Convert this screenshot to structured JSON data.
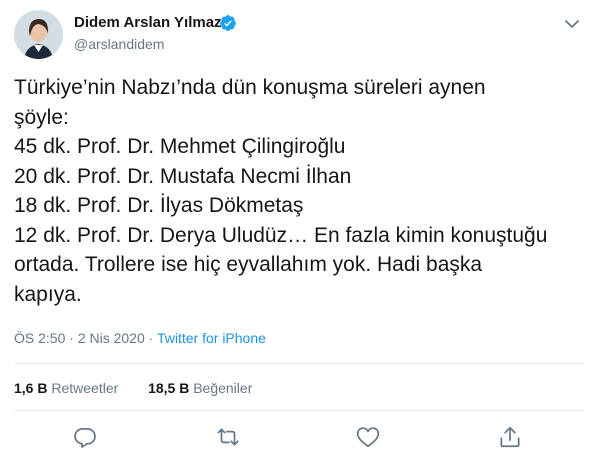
{
  "author": {
    "name": "Didem Arslan Yılmaz",
    "handle": "@arslandidem"
  },
  "tweet": {
    "lines": [
      "Türkiye’nin Nabzı’nda dün konuşma süreleri aynen",
      "şöyle:",
      "45 dk. Prof. Dr. Mehmet Çilingiroğlu",
      "20 dk. Prof. Dr. Mustafa Necmi İlhan",
      "18 dk. Prof. Dr. İlyas Dökmetaş",
      "12 dk. Prof. Dr. Derya Uludüz… En fazla kimin konuştuğu",
      "ortada. Trollere ise hiç eyvallahım yok. Hadi başka",
      "kapıya."
    ]
  },
  "meta": {
    "time": "ÖS 2:50",
    "separator1": " · ",
    "date": "2 Nis 2020",
    "separator2": " · ",
    "source": "Twitter for iPhone"
  },
  "stats": {
    "retweets_count": "1,6 B",
    "retweets_label": "Retweetler",
    "likes_count": "18,5 B",
    "likes_label": "Beğeniler"
  },
  "icons": {
    "verified": "verified-badge-icon",
    "caret": "chevron-down-icon",
    "reply": "reply-icon",
    "retweet": "retweet-icon",
    "like": "heart-icon",
    "share": "share-icon"
  },
  "colors": {
    "accent": "#1da1f2",
    "link": "#1b95e0",
    "muted": "#657786",
    "text": "#14171a"
  }
}
